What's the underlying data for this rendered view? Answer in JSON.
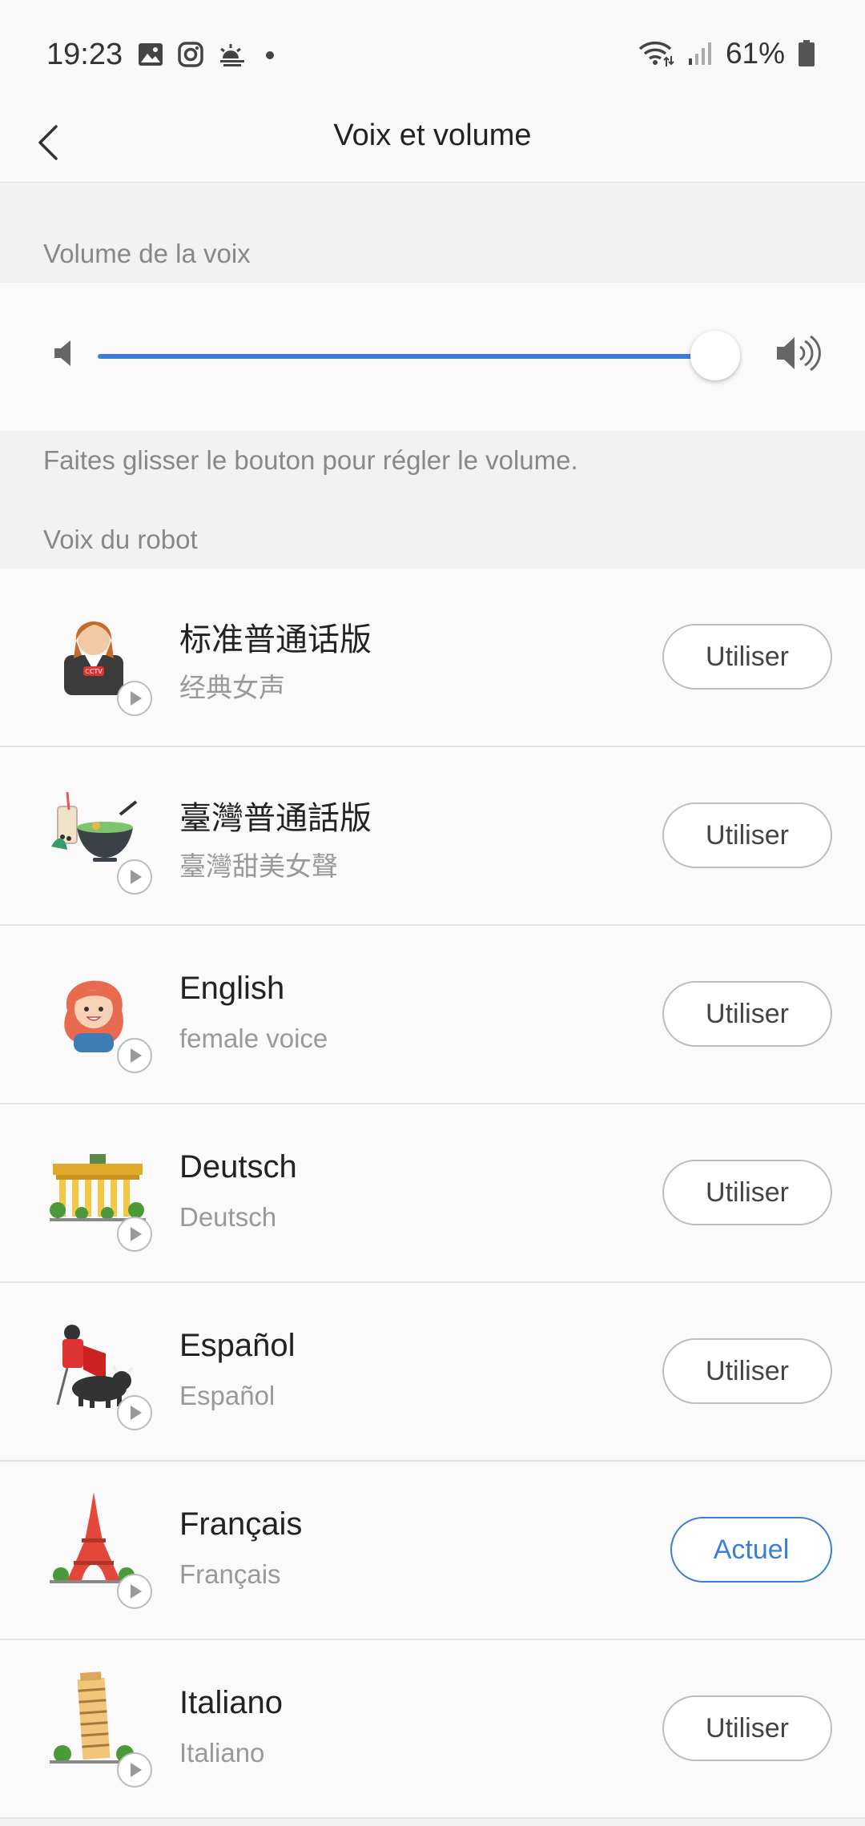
{
  "status_bar": {
    "time": "19:23",
    "battery": "61%",
    "icons": [
      "gallery-icon",
      "instagram-icon",
      "weather-icon",
      "dot-icon",
      "wifi-icon",
      "signal-icon",
      "battery-icon"
    ]
  },
  "header": {
    "title": "Voix et volume",
    "back_icon": "chevron-left-icon"
  },
  "volume": {
    "section_label": "Volume de la voix",
    "level": 0.97,
    "help_text": "Faites glisser le bouton pour régler le volume.",
    "accent_color": "#3a7fd6"
  },
  "voices": {
    "section_label": "Voix du robot",
    "items": [
      {
        "name": "标准普通话版",
        "subtitle": "经典女声",
        "button": "Utiliser",
        "current": false,
        "avatar": "news-anchor-icon"
      },
      {
        "name": "臺灣普通話版",
        "subtitle": "臺灣甜美女聲",
        "button": "Utiliser",
        "current": false,
        "avatar": "bubble-tea-noodles-icon"
      },
      {
        "name": "English",
        "subtitle": "female voice",
        "button": "Utiliser",
        "current": false,
        "avatar": "red-hair-girl-icon"
      },
      {
        "name": "Deutsch",
        "subtitle": "Deutsch",
        "button": "Utiliser",
        "current": false,
        "avatar": "brandenburg-gate-icon"
      },
      {
        "name": "Español",
        "subtitle": "Español",
        "button": "Utiliser",
        "current": false,
        "avatar": "bullfighter-icon"
      },
      {
        "name": "Français",
        "subtitle": "Français",
        "button": "Actuel",
        "current": true,
        "avatar": "eiffel-tower-icon"
      },
      {
        "name": "Italiano",
        "subtitle": "Italiano",
        "button": "Utiliser",
        "current": false,
        "avatar": "leaning-tower-icon"
      }
    ]
  }
}
